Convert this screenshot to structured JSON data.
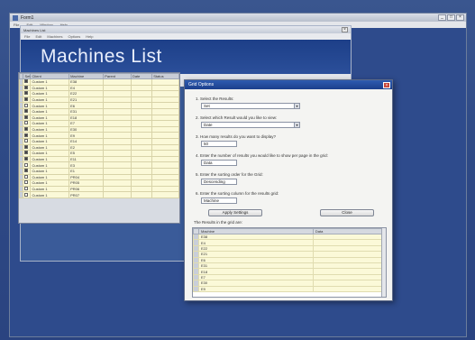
{
  "outer_window": {
    "title": "Form1",
    "menu": [
      "File",
      "Edit",
      "Window",
      "Help"
    ],
    "controls": [
      "_",
      "□",
      "×"
    ]
  },
  "machines_window": {
    "title": "Machines List",
    "menu": [
      "File",
      "Edit",
      "Machines",
      "Options",
      "Help"
    ],
    "banner_title": "Machines List",
    "filter_label": "Select a Results for editing the Results:",
    "filter_value": "Custom List",
    "columns": [
      "",
      "Set",
      "Client",
      "Machine",
      "Parent",
      "Date",
      "Status"
    ],
    "rows": [
      {
        "checked": true,
        "client": "Custom 1",
        "machine": "E38"
      },
      {
        "checked": true,
        "client": "Custom 1",
        "machine": "E4"
      },
      {
        "checked": true,
        "client": "Custom 1",
        "machine": "E22"
      },
      {
        "checked": true,
        "client": "Custom 1",
        "machine": "E21"
      },
      {
        "checked": false,
        "client": "Custom 1",
        "machine": "E6"
      },
      {
        "checked": true,
        "client": "Custom 1",
        "machine": "E31"
      },
      {
        "checked": true,
        "client": "Custom 1",
        "machine": "E18"
      },
      {
        "checked": false,
        "client": "Custom 1",
        "machine": "E7"
      },
      {
        "checked": true,
        "client": "Custom 1",
        "machine": "E30"
      },
      {
        "checked": true,
        "client": "Custom 1",
        "machine": "E9"
      },
      {
        "checked": false,
        "client": "Custom 1",
        "machine": "E14"
      },
      {
        "checked": true,
        "client": "Custom 1",
        "machine": "E2"
      },
      {
        "checked": true,
        "client": "Custom 1",
        "machine": "E5"
      },
      {
        "checked": true,
        "client": "Custom 1",
        "machine": "E11"
      },
      {
        "checked": false,
        "client": "Custom 1",
        "machine": "E3"
      },
      {
        "checked": true,
        "client": "Custom 1",
        "machine": "E1"
      },
      {
        "checked": false,
        "client": "Custom 1",
        "machine": "PR04"
      },
      {
        "checked": false,
        "client": "Custom 1",
        "machine": "PR05"
      },
      {
        "checked": false,
        "client": "Custom 1",
        "machine": "PR06"
      },
      {
        "checked": false,
        "client": "Custom 1",
        "machine": "PR07"
      }
    ]
  },
  "dialog": {
    "title": "Grid Options",
    "q1": "1. Select the Results:",
    "v1": "Set",
    "q2": "2. Select which Result would you like to view:",
    "v2": "Date",
    "q3": "3. How many results do you want to display?",
    "v3": "50",
    "q4": "4. Enter the number of results you would like to show per page in the grid:",
    "v4": "Data",
    "q5": "5. Enter the sorting order for the Grid:",
    "v5": "Descending",
    "q6": "6. Enter the sorting column for the results grid:",
    "v6": "Machine",
    "btn_apply": "Apply Settings",
    "btn_close": "Close",
    "sub_label": "The Results in the grid are:",
    "sub_columns": [
      "",
      "Machine",
      "Data"
    ],
    "sub_rows": [
      "E38",
      "E4",
      "E22",
      "E21",
      "E6",
      "E31",
      "E18",
      "E7",
      "E30",
      "E9"
    ]
  }
}
